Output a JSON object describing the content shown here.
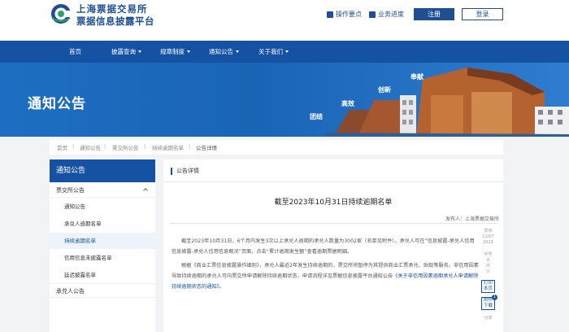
{
  "header": {
    "logo_line1": "上海票据交易所",
    "logo_line2": "票据信息披露平台",
    "link_guide": "操作要点",
    "link_progress": "业务进度",
    "register_label": "注册",
    "login_label": "登录"
  },
  "nav": {
    "items": [
      "首页",
      "披露查询",
      "规章制度",
      "通知公告",
      "关于我们"
    ]
  },
  "banner": {
    "title": "通知公告",
    "words": [
      "团结",
      "高效",
      "创新",
      "奉献"
    ]
  },
  "breadcrumb": [
    "首页",
    "通知公告",
    "票交所公告",
    "持续逾期名单",
    "公告详情"
  ],
  "sidebar": {
    "title": "通知公告",
    "group1": "票交所公告",
    "subitems": [
      "通知公告",
      "承兑人逾期名单",
      "持续逾期名单",
      "信用信息未披露名单",
      "延迟披露名单"
    ],
    "group2": "承兑人公告"
  },
  "content": {
    "header": "公告详情",
    "title": "截至2023年10月31日持续逾期名单",
    "publisher": "发布人：上海票据交易所",
    "para1_a": "截至2023年10月31日，6个月内发生3次以上承兑人逾期的承兑人数量为3002家（名单见附件）。承兑人可在“信息披露-承兑人信用信息披露-承兑人信用信息概况”页面，点击“累计逾期发生额”查看逾期票据明细。",
    "para2_a": "根据《商业汇票信息披露操作细则》，承兑人最近2年发生持续逾期的，票交所将暂停为其提供商业汇票承兑、贴现等服务。非信用因素导致持续逾期的承兑人可向票交所申请解除持续逾期状态，申请流程详见票据信息披露平台通知公告",
    "para2_link": "《关于非信用因素逾期承兑人申请解除持续逾期状态的通知》",
    "para2_end": "。"
  },
  "tools": {
    "pub_date_label": "发布",
    "pub_date": "11/07 2023",
    "font_label": "字号",
    "font_options": [
      "大",
      "中",
      "小"
    ],
    "print_label": "打印本页",
    "attach_label": "附件下载",
    "attach_count": "1",
    "share_label": "分享"
  }
}
